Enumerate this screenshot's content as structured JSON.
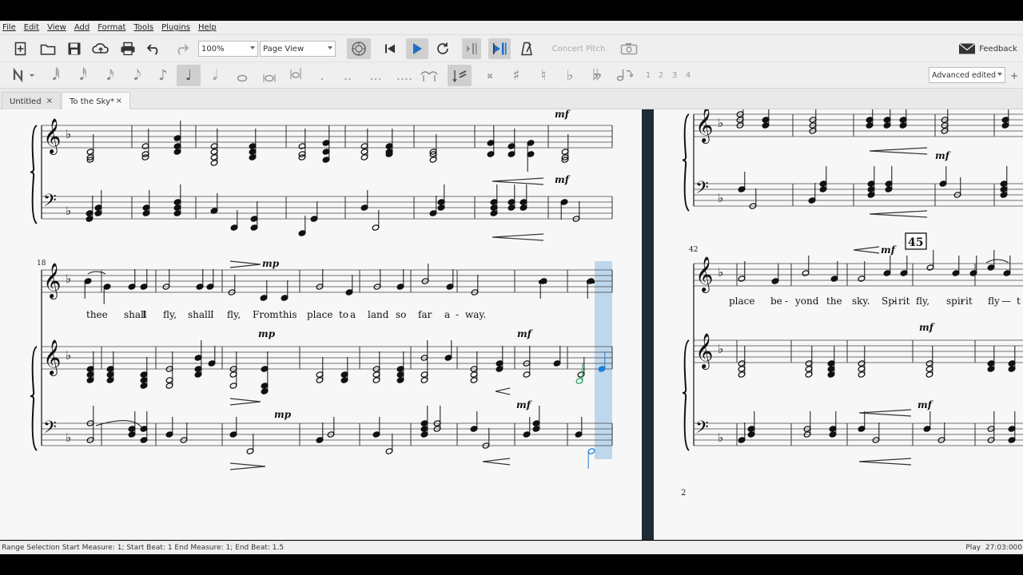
{
  "menu": [
    "File",
    "Edit",
    "View",
    "Add",
    "Format",
    "Tools",
    "Plugins",
    "Help"
  ],
  "toolbar": {
    "zoom": "100%",
    "view_mode": "Page View",
    "concert_pitch": "Concert Pitch",
    "feedback": "Feedback"
  },
  "note_input": {
    "voices": [
      "1",
      "2",
      "3",
      "4"
    ],
    "workspace": "Advanced edited"
  },
  "tabs": [
    {
      "label": "Untitled",
      "close": "×"
    },
    {
      "label": "To the Sky*",
      "close": "×"
    }
  ],
  "score": {
    "key": "♭",
    "system1_measure": "18",
    "system3_measure": "42",
    "rehearsal_mark": "45",
    "page_number": "2",
    "lyrics_left": [
      "thee",
      "shall",
      "I",
      "fly,",
      "shall",
      "I",
      "fly,",
      "From",
      "this",
      "place",
      "to",
      "a",
      "land",
      "so",
      "far",
      "a",
      "-",
      "way."
    ],
    "lyrics_right": [
      "place",
      "be",
      "-",
      "yond",
      "the",
      "sky.",
      "Spi",
      "-",
      "rit",
      "fly,",
      "spir",
      "-",
      "it",
      "fly",
      "—",
      "t"
    ],
    "dynamics": [
      "mf",
      "mp"
    ]
  },
  "status": {
    "left": "Range Selection Start Measure: 1; Start Beat: 1 End Measure: 1; End Beat: 1.5",
    "mode": "Play",
    "time": "27:03:000"
  },
  "colors": {
    "selection": "#b5d1ea",
    "page_divider": "#1e2a36",
    "play_accent": "#1e6fc7",
    "selected_note": "#1f7fd6"
  }
}
